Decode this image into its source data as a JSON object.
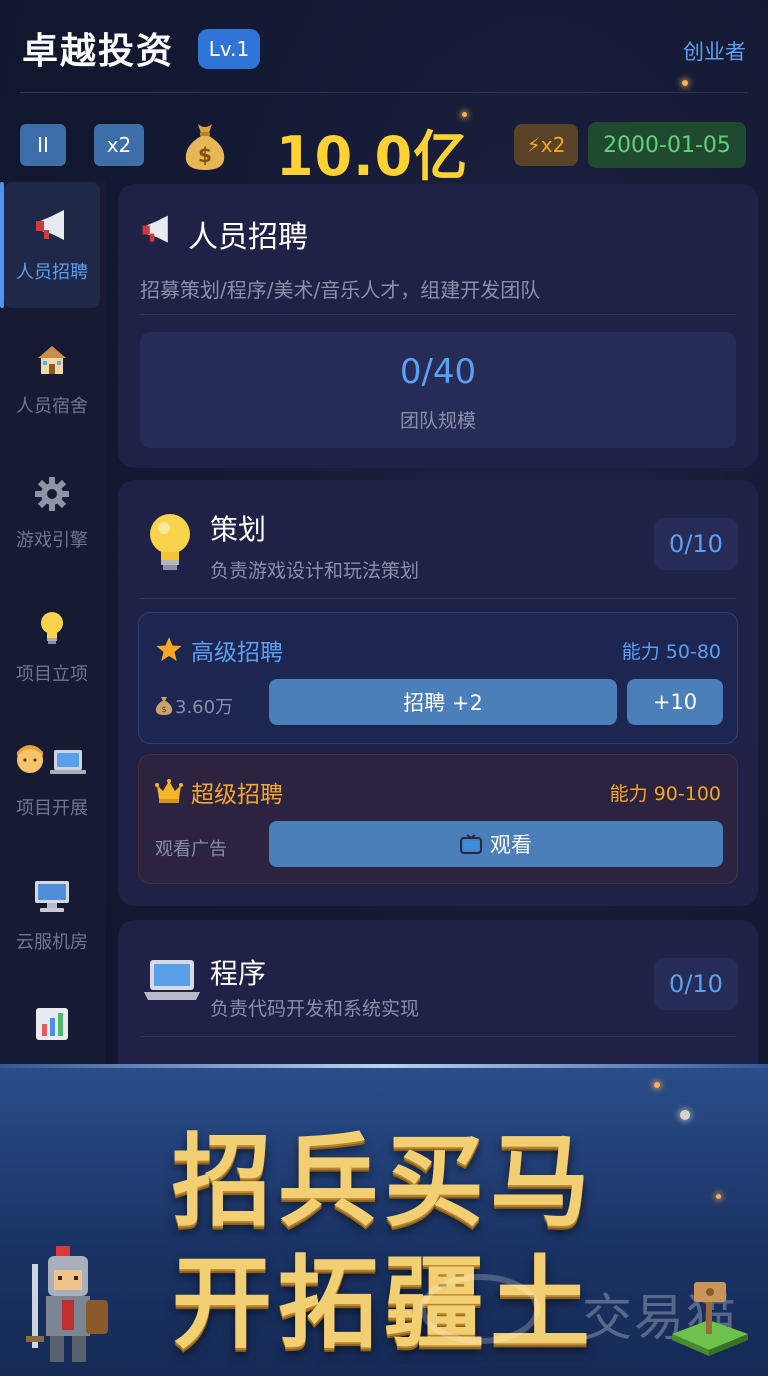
{
  "header": {
    "app_title": "卓越投资",
    "level": "Lv.1",
    "rank": "创业者"
  },
  "status": {
    "pause_label": "II",
    "speed_label": "x2",
    "money": "10.0亿",
    "boost": "⚡x2",
    "date": "2000-01-05"
  },
  "sidebar": {
    "items": [
      {
        "label": "人员招聘",
        "icon": "megaphone-icon",
        "active": true
      },
      {
        "label": "人员宿舍",
        "icon": "house-icon"
      },
      {
        "label": "游戏引擎",
        "icon": "gear-icon"
      },
      {
        "label": "项目立项",
        "icon": "lightbulb-icon"
      },
      {
        "label": "项目开展",
        "icon": "developer-laptop-icon"
      },
      {
        "label": "云服机房",
        "icon": "computer-icon"
      },
      {
        "label": "",
        "icon": "bar-chart-icon"
      }
    ]
  },
  "recruit_panel": {
    "title": "人员招聘",
    "description": "招募策划/程序/美术/音乐人才，组建开发团队",
    "team_size": "0/40",
    "team_label": "团队规模"
  },
  "planning": {
    "title": "策划",
    "description": "负责游戏设计和玩法策划",
    "count": "0/10",
    "senior": {
      "title": "高级招聘",
      "ability": "能力 50-80",
      "cost": "3.60万",
      "hire_label": "招聘 +2",
      "bulk_label": "+10"
    },
    "super": {
      "title": "超级招聘",
      "ability": "能力 90-100",
      "cost_label": "观看广告",
      "watch_label": "观看"
    }
  },
  "programming": {
    "title": "程序",
    "description": "负责代码开发和系统实现",
    "count": "0/10"
  },
  "banner": {
    "line1": "招兵买马",
    "line2": "开拓疆土",
    "watermark": "交易猫"
  },
  "colors": {
    "accent_blue": "#5b9ff0",
    "money_gold": "#ffd233",
    "date_green": "#63d07a",
    "super_orange": "#f5a623"
  }
}
